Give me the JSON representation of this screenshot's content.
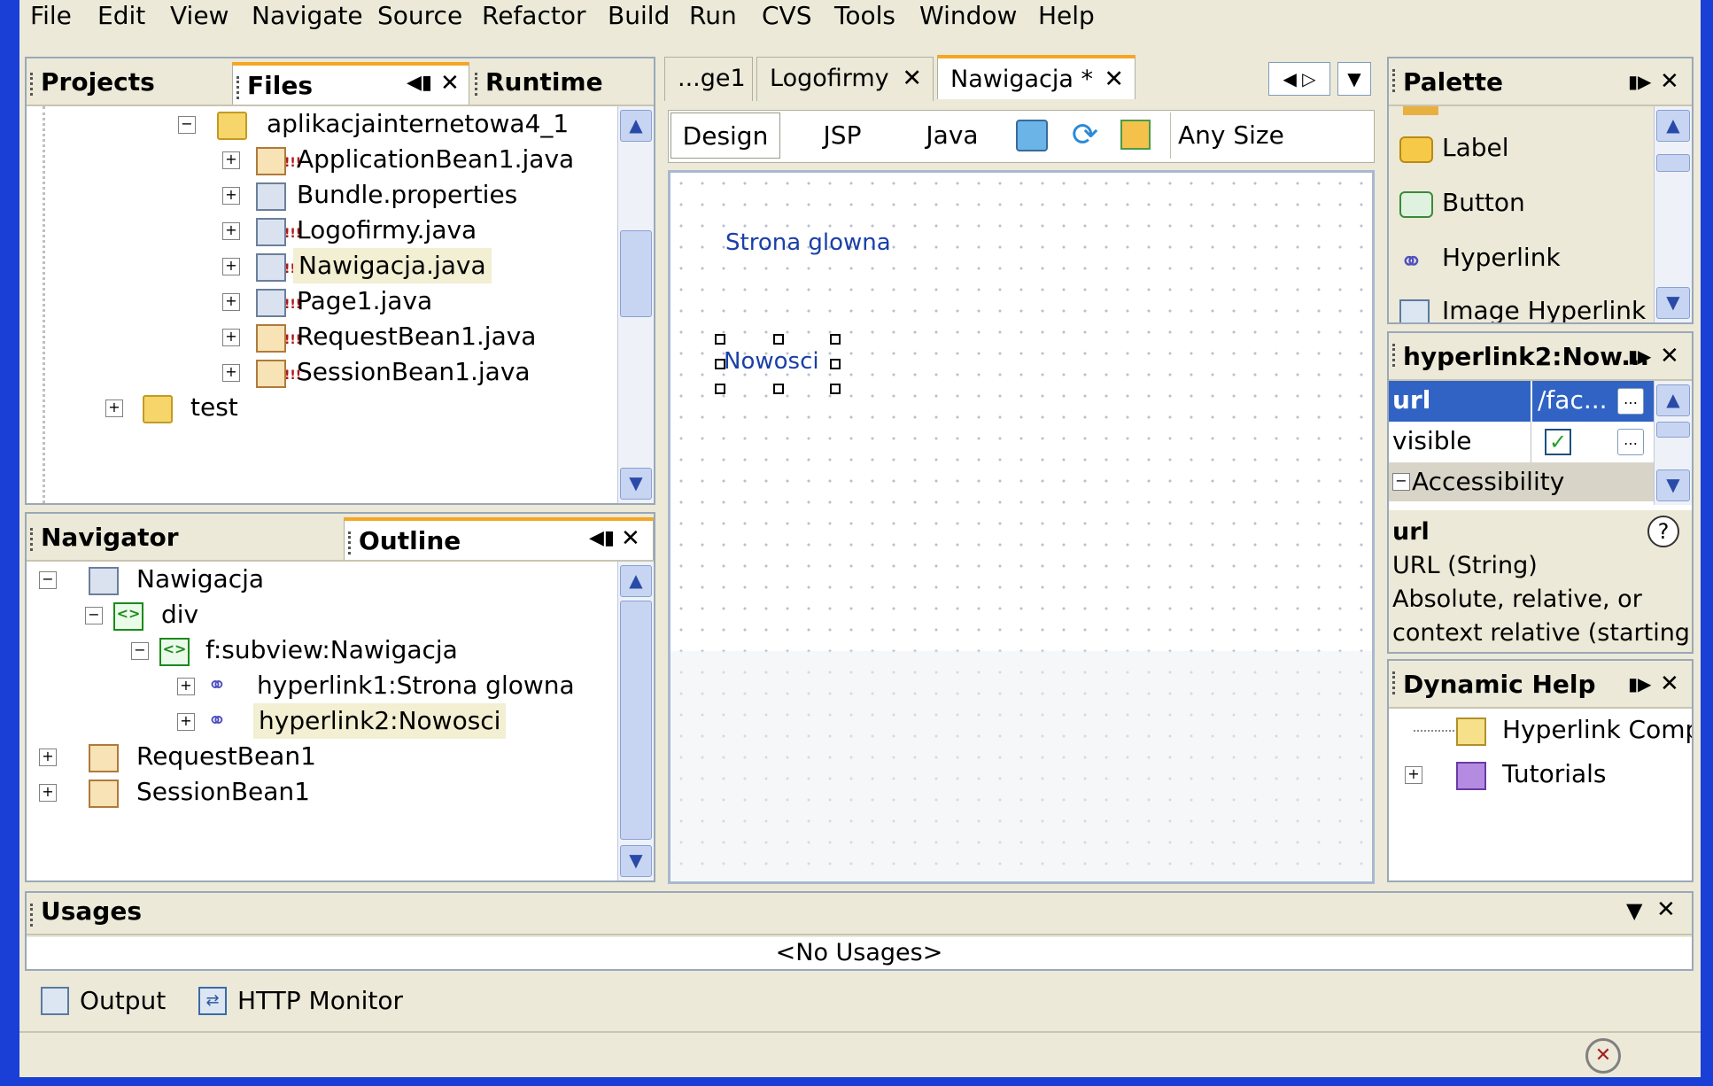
{
  "menu": [
    "File",
    "Edit",
    "View",
    "Navigate",
    "Source",
    "Refactor",
    "Build",
    "Run",
    "CVS",
    "Tools",
    "Window",
    "Help"
  ],
  "files_panel": {
    "tabs": [
      "Projects",
      "Files",
      "Runtime"
    ],
    "active_tab": "Files",
    "tree": [
      {
        "label": "aplikacjainternetowa4_1",
        "type": "folder"
      },
      {
        "label": "ApplicationBean1.java",
        "type": "bean"
      },
      {
        "label": "Bundle.properties",
        "type": "props"
      },
      {
        "label": "Logofirmy.java",
        "type": "page"
      },
      {
        "label": "Nawigacja.java",
        "type": "page",
        "selected": true
      },
      {
        "label": "Page1.java",
        "type": "page"
      },
      {
        "label": "RequestBean1.java",
        "type": "bean"
      },
      {
        "label": "SessionBean1.java",
        "type": "bean"
      },
      {
        "label": "test",
        "type": "folder"
      }
    ]
  },
  "outline_panel": {
    "tabs": [
      "Navigator",
      "Outline"
    ],
    "active_tab": "Outline",
    "tree": [
      {
        "label": "Nawigacja"
      },
      {
        "label": "div"
      },
      {
        "label": "f:subview:Nawigacja"
      },
      {
        "label": "hyperlink1:Strona glowna"
      },
      {
        "label": "hyperlink2:Nowosci",
        "selected": true
      },
      {
        "label": "RequestBean1"
      },
      {
        "label": "SessionBean1"
      }
    ]
  },
  "editor": {
    "tabs": [
      "...ge1",
      "Logofirmy",
      "Nawigacja *"
    ],
    "active_tab": "Nawigacja *",
    "modes": [
      "Design",
      "JSP",
      "Java"
    ],
    "active_mode": "Design",
    "size_select": "Any Size",
    "canvas": {
      "link1": "Strona glowna",
      "link2": "Nowosci"
    }
  },
  "palette": {
    "title": "Palette",
    "items": [
      "Label",
      "Button",
      "Hyperlink",
      "Image Hyperlink"
    ]
  },
  "properties": {
    "title": "hyperlink2:Now...",
    "rows": [
      {
        "key": "url",
        "value": "/fac...",
        "selected": true
      },
      {
        "key": "visible",
        "value": "checked"
      }
    ],
    "category": "Accessibility",
    "help_title": "url",
    "help_type": "URL (String)",
    "help_text1": "Absolute, relative, or",
    "help_text2": "context relative (starting"
  },
  "dynamic_help": {
    "title": "Dynamic Help",
    "items": [
      "Hyperlink Compon",
      "Tutorials"
    ]
  },
  "usages": {
    "title": "Usages",
    "message": "<No Usages>"
  },
  "bottom_tabs": [
    "Output",
    "HTTP Monitor"
  ]
}
